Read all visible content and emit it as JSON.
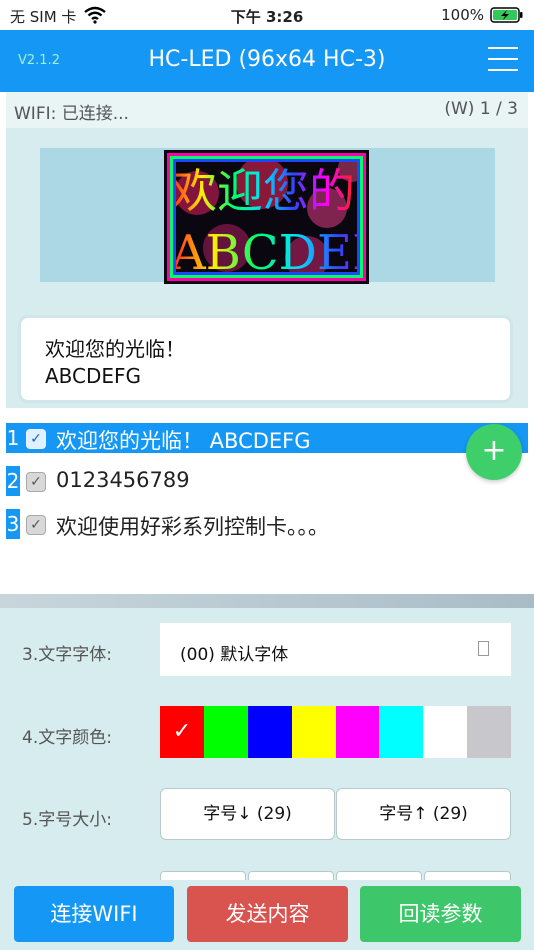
{
  "status_bar": {
    "carrier": "无 SIM 卡",
    "time": "下午 3:26",
    "battery": "100%"
  },
  "nav": {
    "version": "V2.1.2",
    "title": "HC-LED (96x64 HC-3)",
    "menu_icon": "hamburger-menu-icon"
  },
  "wifi": {
    "status": "WIFI: 已连接...",
    "page": "(W) 1 / 3"
  },
  "preview": {
    "line1": "欢迎您的",
    "line2": "ABCDEFG"
  },
  "editor": {
    "line1": "欢迎您的光临！",
    "line2": "ABCDEFG"
  },
  "programs": [
    {
      "num": "1",
      "label": "欢迎您的光临！  ABCDEFG",
      "checked": true,
      "selected": true
    },
    {
      "num": "2",
      "label": "0123456789",
      "checked": true,
      "selected": false
    },
    {
      "num": "3",
      "label": "欢迎使用好彩系列控制卡。。。",
      "checked": true,
      "selected": false
    }
  ],
  "settings": {
    "font_label": "3.文字字体:",
    "font_value": "(00) 默认字体",
    "color_label": "4.文字颜色:",
    "colors": [
      "#ff0000",
      "#00ff00",
      "#0000ff",
      "#ffff00",
      "#ff00ff",
      "#00ffff",
      "#ffffff",
      "#c8c8cc"
    ],
    "selected_color_index": 0,
    "check_mark": "✓",
    "size_label": "5.字号大小:",
    "size_down": "字号↓ (29)",
    "size_up": "字号↑ (29)"
  },
  "actions": {
    "connect_wifi": "连接WIFI",
    "send_content": "发送内容",
    "read_params": "回读参数"
  },
  "add_label": "+"
}
